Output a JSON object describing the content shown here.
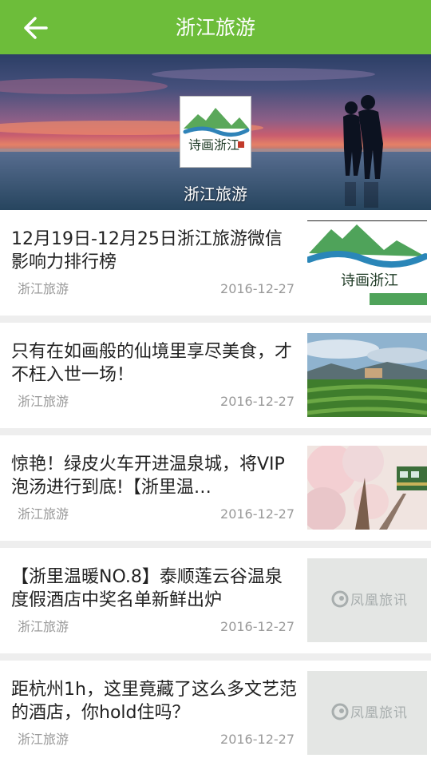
{
  "header": {
    "back_icon": "arrow-left-icon",
    "title": "浙江旅游",
    "color": "#6dbd3a"
  },
  "banner": {
    "caption": "浙江旅游",
    "logo_text": "诗画浙江"
  },
  "articles": [
    {
      "title": "12月19日-12月25日浙江旅游微信影响力排行榜",
      "source": "浙江旅游",
      "date": "2016-12-27",
      "thumb": "poetic-zhejiang-logo"
    },
    {
      "title": "只有在如画般的仙境里享尽美食，才不枉入世一场！",
      "source": "浙江旅游",
      "date": "2016-12-27",
      "thumb": "tea-field-photo"
    },
    {
      "title": "惊艳！绿皮火车开进温泉城，将VIP泡汤进行到底!【浙里温…",
      "source": "浙江旅游",
      "date": "2016-12-27",
      "thumb": "cherry-blossom-train-photo"
    },
    {
      "title": "【浙里温暖NO.8】泰顺莲云谷温泉度假酒店中奖名单新鲜出炉",
      "source": "浙江旅游",
      "date": "2016-12-27",
      "thumb": "placeholder",
      "placeholder_text": "凤凰旅讯"
    },
    {
      "title": "距杭州1h，这里竟藏了这么多文艺范的酒店，你hold住吗？",
      "source": "浙江旅游",
      "date": "2016-12-27",
      "thumb": "placeholder",
      "placeholder_text": "凤凰旅讯"
    }
  ]
}
